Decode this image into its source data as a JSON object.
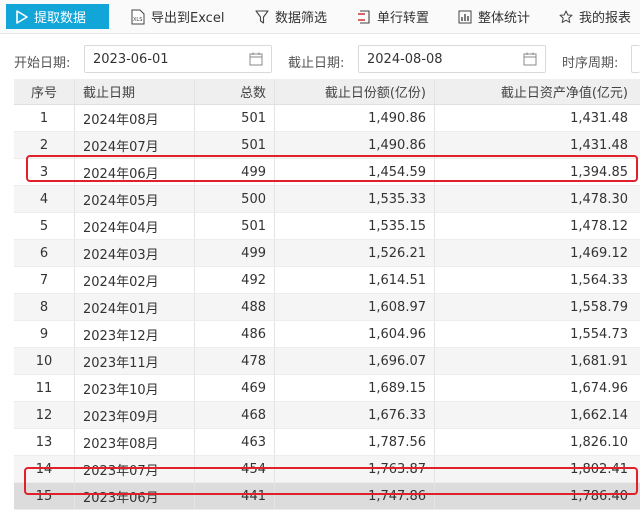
{
  "toolbar": {
    "extract_label": "提取数据",
    "export_label": "导出到Excel",
    "filter_label": "数据筛选",
    "transpose_label": "单行转置",
    "stats_label": "整体统计",
    "report_label": "我的报表"
  },
  "filters": {
    "start_label": "开始日期:",
    "start_value": "2023-06-01",
    "end_label": "截止日期:",
    "end_value": "2024-08-08",
    "period_label": "时序周期:"
  },
  "table": {
    "columns": [
      "序号",
      "截止日期",
      "总数",
      "截止日份额(亿份)",
      "截止日资产净值(亿元)"
    ],
    "rows": [
      {
        "idx": "1",
        "date": "2024年08月",
        "total": "501",
        "share": "1,490.86",
        "nav": "1,431.48"
      },
      {
        "idx": "2",
        "date": "2024年07月",
        "total": "501",
        "share": "1,490.86",
        "nav": "1,431.48"
      },
      {
        "idx": "3",
        "date": "2024年06月",
        "total": "499",
        "share": "1,454.59",
        "nav": "1,394.85"
      },
      {
        "idx": "4",
        "date": "2024年05月",
        "total": "500",
        "share": "1,535.33",
        "nav": "1,478.30"
      },
      {
        "idx": "5",
        "date": "2024年04月",
        "total": "501",
        "share": "1,535.15",
        "nav": "1,478.12"
      },
      {
        "idx": "6",
        "date": "2024年03月",
        "total": "499",
        "share": "1,526.21",
        "nav": "1,469.12"
      },
      {
        "idx": "7",
        "date": "2024年02月",
        "total": "492",
        "share": "1,614.51",
        "nav": "1,564.33"
      },
      {
        "idx": "8",
        "date": "2024年01月",
        "total": "488",
        "share": "1,608.97",
        "nav": "1,558.79"
      },
      {
        "idx": "9",
        "date": "2023年12月",
        "total": "486",
        "share": "1,604.96",
        "nav": "1,554.73"
      },
      {
        "idx": "10",
        "date": "2023年11月",
        "total": "478",
        "share": "1,696.07",
        "nav": "1,681.91"
      },
      {
        "idx": "11",
        "date": "2023年10月",
        "total": "469",
        "share": "1,689.15",
        "nav": "1,674.96"
      },
      {
        "idx": "12",
        "date": "2023年09月",
        "total": "468",
        "share": "1,676.33",
        "nav": "1,662.14"
      },
      {
        "idx": "13",
        "date": "2023年08月",
        "total": "463",
        "share": "1,787.56",
        "nav": "1,826.10"
      },
      {
        "idx": "14",
        "date": "2023年07月",
        "total": "454",
        "share": "1,763.87",
        "nav": "1,802.41"
      },
      {
        "idx": "15",
        "date": "2023年06月",
        "total": "441",
        "share": "1,747.86",
        "nav": "1,786.40"
      }
    ]
  },
  "colors": {
    "accent": "#12a6d8",
    "highlight": "#e0202a"
  }
}
